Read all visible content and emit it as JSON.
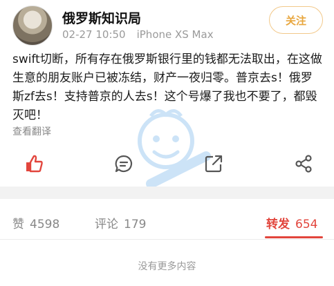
{
  "header": {
    "username": "俄罗斯知识局",
    "time": "02-27 10:50",
    "device": "iPhone XS Max",
    "follow_label": "关注"
  },
  "post": {
    "text": "swift切断，所有存在俄罗斯银行里的钱都无法取出，在这做生意的朋友账户已被冻结，财产一夜归零。普京去s！俄罗斯zf去s！支持普京的人去s！这个号爆了我也不要了，都毁灭吧！",
    "translate_label": "查看翻译"
  },
  "actions": {
    "icons": [
      "like-icon",
      "comment-icon",
      "share-icon",
      "more-share-icon"
    ]
  },
  "stats": {
    "likes_label": "赞",
    "likes_count": "4598",
    "comments_label": "评论",
    "comments_count": "179",
    "reposts_label": "转发",
    "reposts_count": "654"
  },
  "footer": {
    "note": "没有更多内容"
  },
  "colors": {
    "accent_orange": "#e8a63d",
    "like_red": "#e2453c",
    "repost_red": "#e2453c"
  }
}
